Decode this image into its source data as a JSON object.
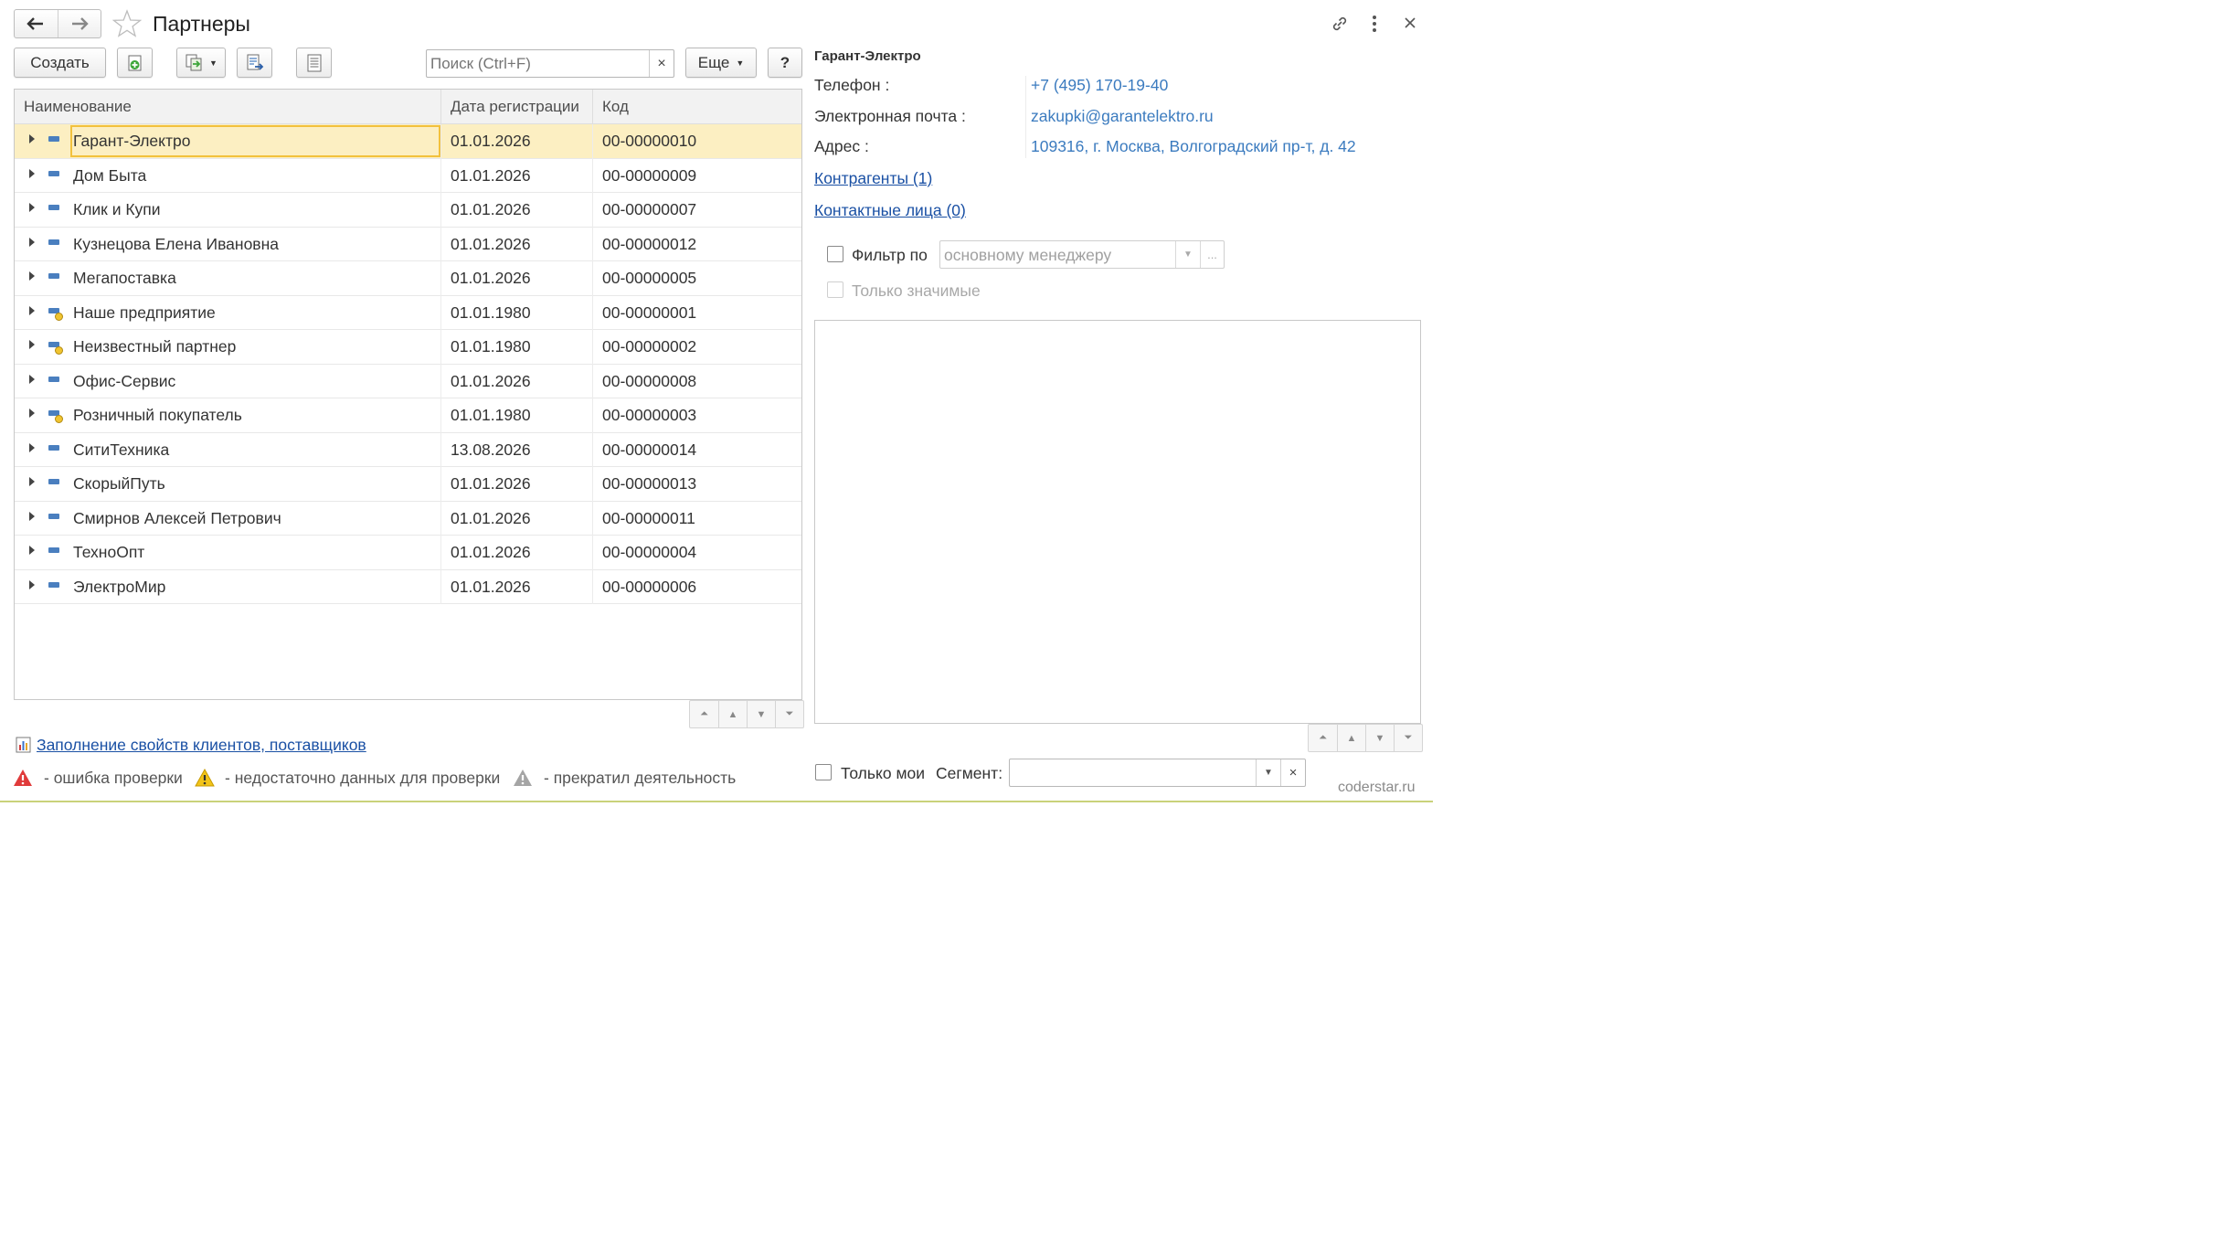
{
  "window": {
    "title": "Партнеры"
  },
  "toolbar": {
    "create_label": "Создать",
    "search_placeholder": "Поиск (Ctrl+F)",
    "search_clear": "×",
    "more_label": "Еще",
    "help_label": "?"
  },
  "grid": {
    "columns": [
      "Наименование",
      "Дата регистрации",
      "Код"
    ],
    "rows": [
      {
        "name": "Гарант-Электро",
        "date": "01.01.2026",
        "code": "00-00000010",
        "selected": true,
        "predefined": false
      },
      {
        "name": "Дом Быта",
        "date": "01.01.2026",
        "code": "00-00000009",
        "selected": false,
        "predefined": false
      },
      {
        "name": "Клик и Купи",
        "date": "01.01.2026",
        "code": "00-00000007",
        "selected": false,
        "predefined": false
      },
      {
        "name": "Кузнецова Елена Ивановна",
        "date": "01.01.2026",
        "code": "00-00000012",
        "selected": false,
        "predefined": false
      },
      {
        "name": "Мегапоставка",
        "date": "01.01.2026",
        "code": "00-00000005",
        "selected": false,
        "predefined": false
      },
      {
        "name": "Наше предприятие",
        "date": "01.01.1980",
        "code": "00-00000001",
        "selected": false,
        "predefined": true
      },
      {
        "name": "Неизвестный партнер",
        "date": "01.01.1980",
        "code": "00-00000002",
        "selected": false,
        "predefined": true
      },
      {
        "name": "Офис-Сервис",
        "date": "01.01.2026",
        "code": "00-00000008",
        "selected": false,
        "predefined": false
      },
      {
        "name": "Розничный покупатель",
        "date": "01.01.1980",
        "code": "00-00000003",
        "selected": false,
        "predefined": true
      },
      {
        "name": "СитиТехника",
        "date": "13.08.2026",
        "code": "00-00000014",
        "selected": false,
        "predefined": false
      },
      {
        "name": "СкорыйПуть",
        "date": "01.01.2026",
        "code": "00-00000013",
        "selected": false,
        "predefined": false
      },
      {
        "name": "Смирнов Алексей Петрович",
        "date": "01.01.2026",
        "code": "00-00000011",
        "selected": false,
        "predefined": false
      },
      {
        "name": "ТехноОпт",
        "date": "01.01.2026",
        "code": "00-00000004",
        "selected": false,
        "predefined": false
      },
      {
        "name": "ЭлектроМир",
        "date": "01.01.2026",
        "code": "00-00000006",
        "selected": false,
        "predefined": false
      }
    ]
  },
  "footer": {
    "report_link": "Заполнение свойств клиентов, поставщиков",
    "legend": [
      {
        "icon": "error-warning-icon",
        "color": "#e03b3b",
        "text": "- ошибка проверки"
      },
      {
        "icon": "insufficient-data-icon",
        "color": "#f2c419",
        "text": "- недостаточно данных для проверки"
      },
      {
        "icon": "ceased-activity-icon",
        "color": "#9a9a9a",
        "text": "- прекратил деятельность"
      }
    ]
  },
  "details": {
    "title": "Гарант-Электро",
    "phone_label": "Телефон :",
    "phone_value": "+7 (495) 170-19-40",
    "email_label": "Электронная почта :",
    "email_value": "zakupki@garantelektro.ru",
    "address_label": "Адрес :",
    "address_value": "109316, г. Москва, Волгоградский пр-т, д. 42",
    "counterparties_link": "Контрагенты (1)",
    "contacts_link": "Контактные лица (0)",
    "filter_label": "Фильтр по",
    "filter_value": "основному менеджеру",
    "filter_dots": "...",
    "significant_label": "Только значимые",
    "only_mine_label": "Только мои",
    "segment_label": "Сегмент:",
    "segment_clear": "×"
  },
  "watermark": "coderstar.ru",
  "colors": {
    "selection": "#fcefc2",
    "focus": "#f2c13d",
    "link": "#1a50a4",
    "value": "#3b7bbf"
  }
}
